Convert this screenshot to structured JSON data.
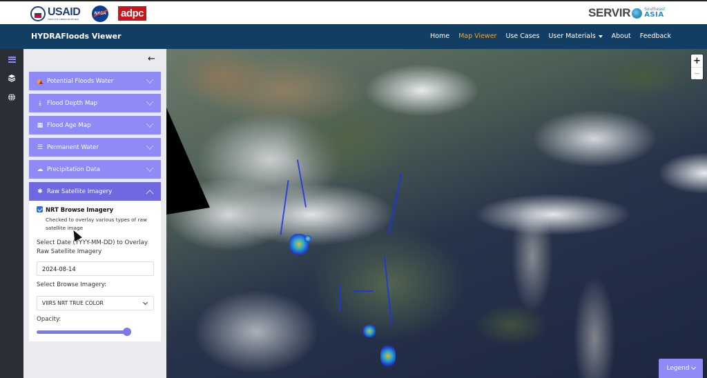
{
  "topbar": {
    "logos": {
      "usaid": {
        "text": "USAID",
        "tagline": "FROM THE AMERICAN PEOPLE"
      },
      "nasa": {
        "text": "NASA"
      },
      "adpc": {
        "text": "adpc"
      },
      "servir": {
        "text": "SERVIR",
        "region_small": "Southeast",
        "region": "ASIA"
      }
    }
  },
  "navbar": {
    "brand": "HYDRAFloods Viewer",
    "links": [
      {
        "label": "Home",
        "active": false
      },
      {
        "label": "Map Viewer",
        "active": true
      },
      {
        "label": "Use Cases",
        "active": false
      },
      {
        "label": "User Materials",
        "active": false,
        "dropdown": true
      },
      {
        "label": "About",
        "active": false
      },
      {
        "label": "Feedback",
        "active": false
      }
    ],
    "active_color": "#f5a623"
  },
  "rail": {
    "items": [
      {
        "icon": "menu-icon",
        "active": true
      },
      {
        "icon": "layers-icon",
        "active": false
      },
      {
        "icon": "globe-icon",
        "active": false
      }
    ]
  },
  "panel": {
    "collapse_icon": "←",
    "sections": [
      {
        "label": "Potential Floods Water",
        "icon": "house-flood-icon",
        "glyph": "⛺",
        "expanded": false
      },
      {
        "label": "Flood Depth Map",
        "icon": "depth-icon",
        "glyph": "⤓",
        "expanded": false
      },
      {
        "label": "Flood Age Map",
        "icon": "calendar-icon",
        "glyph": "▦",
        "expanded": false
      },
      {
        "label": "Permanent Water",
        "icon": "water-lines-icon",
        "glyph": "☰",
        "expanded": false
      },
      {
        "label": "Precipitation Data",
        "icon": "cloud-rain-icon",
        "glyph": "☁",
        "expanded": false
      },
      {
        "label": "Raw Satellite Imagery",
        "icon": "satellite-icon",
        "glyph": "✱",
        "expanded": true
      }
    ],
    "raw_satellite": {
      "checkbox_label": "NRT Browse Imagery",
      "checkbox_checked": true,
      "checkbox_help": "Checked to overlay various types of raw satellite image",
      "date_label": "Select Date (YYYY-MM-DD) to Overlay Raw Satellite Imagery",
      "date_value": "2024-08-14",
      "imagery_label": "Select Browse Imagery:",
      "imagery_selected": "VIIRS NRT TRUE COLOR",
      "opacity_label": "Opacity:",
      "opacity_value": 1.0
    }
  },
  "map": {
    "zoom_in": "+",
    "zoom_out": "−",
    "legend_label": "Legend"
  },
  "colors": {
    "navbar": "#133e63",
    "accordion": "#8e8bf6",
    "accordion_open": "#6e69e0",
    "rail": "#2a2e35"
  }
}
